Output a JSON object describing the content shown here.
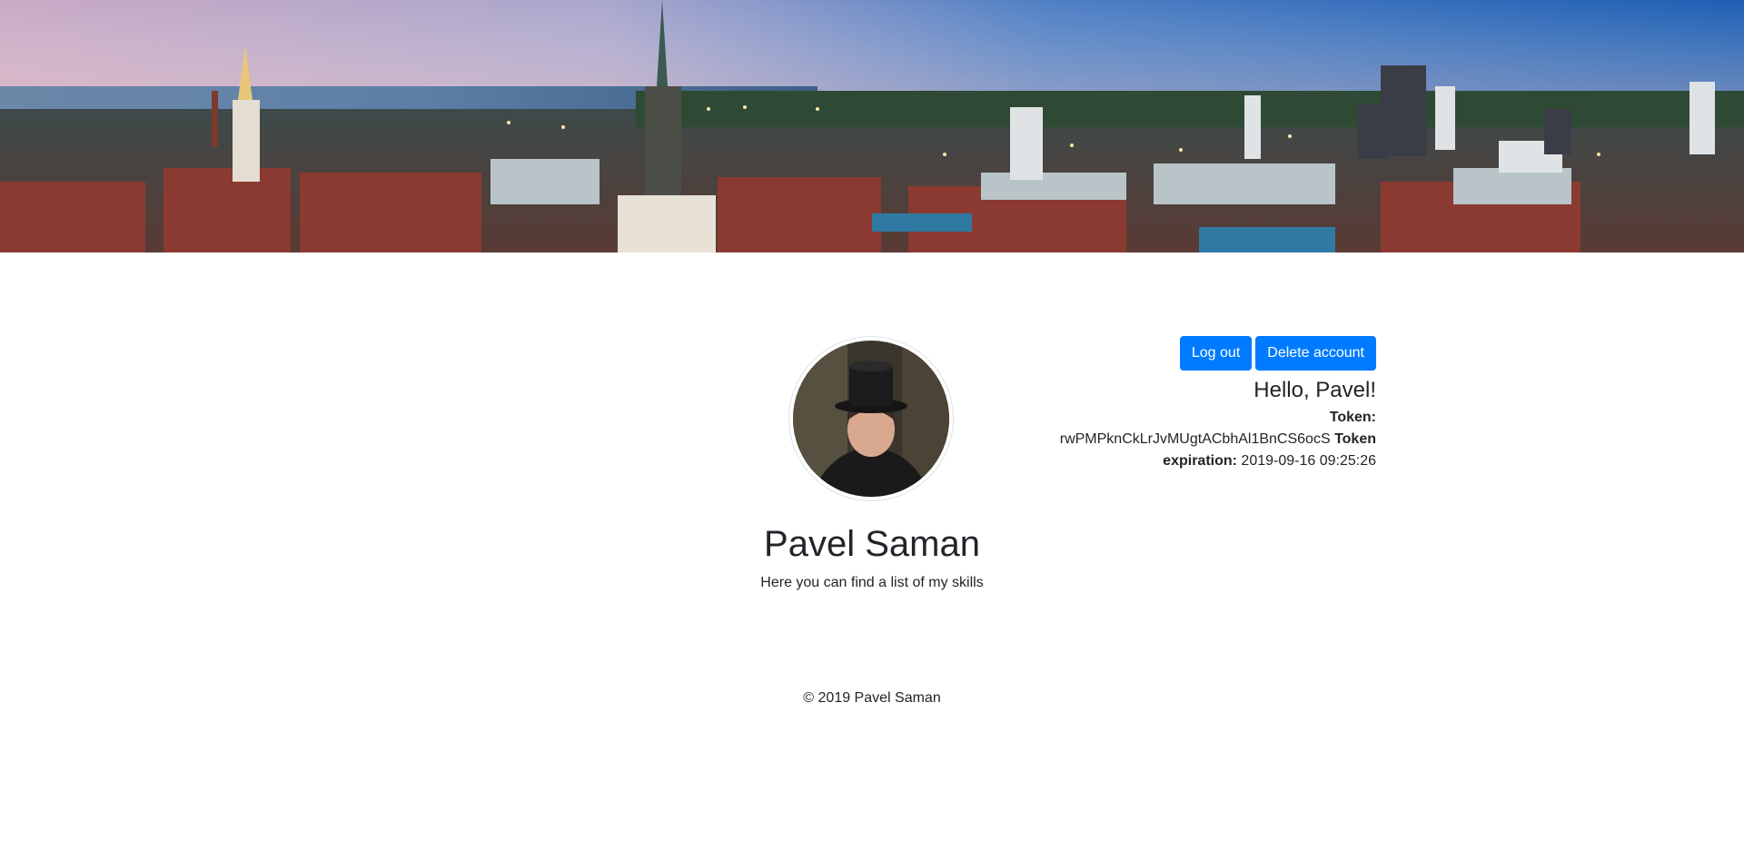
{
  "account": {
    "logout_label": "Log out",
    "delete_label": "Delete account",
    "greeting": "Hello, Pavel!",
    "token_label": "Token:",
    "token_value": "rwPMPknCkLrJvMUgtACbhAl1BnCS6ocS",
    "expiration_label_1": "Token",
    "expiration_label_2": "expiration:",
    "expiration_value": "2019-09-16 09:25:26"
  },
  "profile": {
    "name": "Pavel Saman",
    "subtitle": "Here you can find a list of my skills"
  },
  "footer": {
    "text": "© 2019 Pavel Saman"
  },
  "colors": {
    "primary": "#007bff",
    "text": "#212529"
  }
}
